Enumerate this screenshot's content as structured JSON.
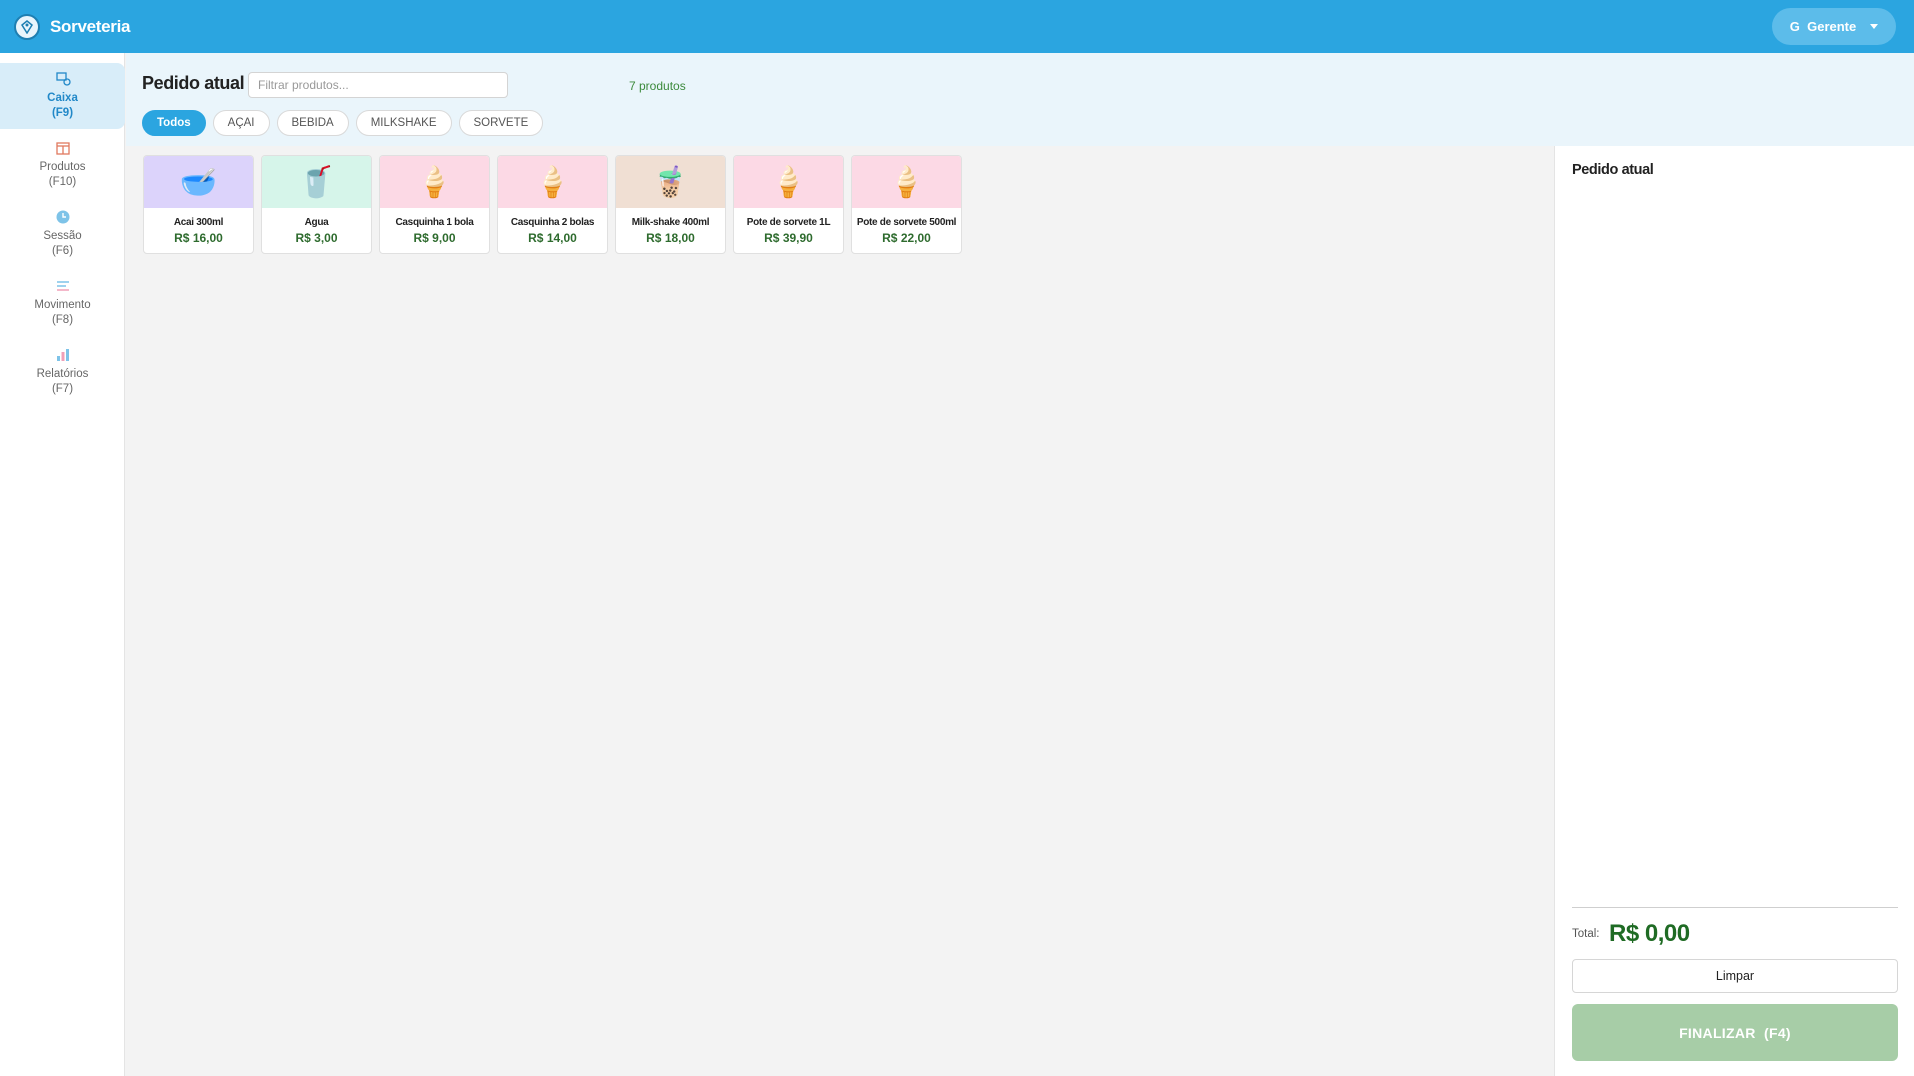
{
  "app": {
    "title": "Sorveteria",
    "user_label": "G  Gerente"
  },
  "sidebar": {
    "items": [
      {
        "label": "Caixa",
        "shortcut": "(F9)",
        "icon": "register-icon"
      },
      {
        "label": "Produtos",
        "shortcut": "(F10)",
        "icon": "box-icon"
      },
      {
        "label": "Sessão",
        "shortcut": "(F6)",
        "icon": "clock-icon"
      },
      {
        "label": "Movimento",
        "shortcut": "(F8)",
        "icon": "lines-icon"
      },
      {
        "label": "Relatórios",
        "shortcut": "(F7)",
        "icon": "bar-chart-icon"
      }
    ]
  },
  "header": {
    "title": "Pedido atual",
    "search_placeholder": "Filtrar produtos...",
    "count": "7 produtos",
    "chips": [
      "Todos",
      "AÇAI",
      "BEBIDA",
      "MILKSHAKE",
      "SORVETE"
    ]
  },
  "products": [
    {
      "name": "Acai 300ml",
      "price": "R$ 16,00",
      "emoji": "🥣",
      "bg": "#dcd3fb"
    },
    {
      "name": "Agua",
      "price": "R$ 3,00",
      "emoji": "🥤",
      "bg": "#d6f5ea"
    },
    {
      "name": "Casquinha 1 bola",
      "price": "R$ 9,00",
      "emoji": "🍦",
      "bg": "#fcd9e5"
    },
    {
      "name": "Casquinha 2 bolas",
      "price": "R$ 14,00",
      "emoji": "🍦",
      "bg": "#fcd9e5"
    },
    {
      "name": "Milk-shake 400ml",
      "price": "R$ 18,00",
      "emoji": "🧋",
      "bg": "#f0dfd3"
    },
    {
      "name": "Pote de sorvete 1L",
      "price": "R$ 39,90",
      "emoji": "🍦",
      "bg": "#fcd9e5"
    },
    {
      "name": "Pote de sorvete 500ml",
      "price": "R$ 22,00",
      "emoji": "🍦",
      "bg": "#fcd9e5"
    }
  ],
  "order": {
    "title": "Pedido atual",
    "total_label": "Total:",
    "total_value": "R$ 0,00",
    "clear_label": "Limpar",
    "finish_label": "FINALIZAR  (F4)"
  },
  "colors": {
    "primary": "#2ba5e0",
    "price_green": "#2e6b2e",
    "finish_disabled": "#a7cda7"
  }
}
